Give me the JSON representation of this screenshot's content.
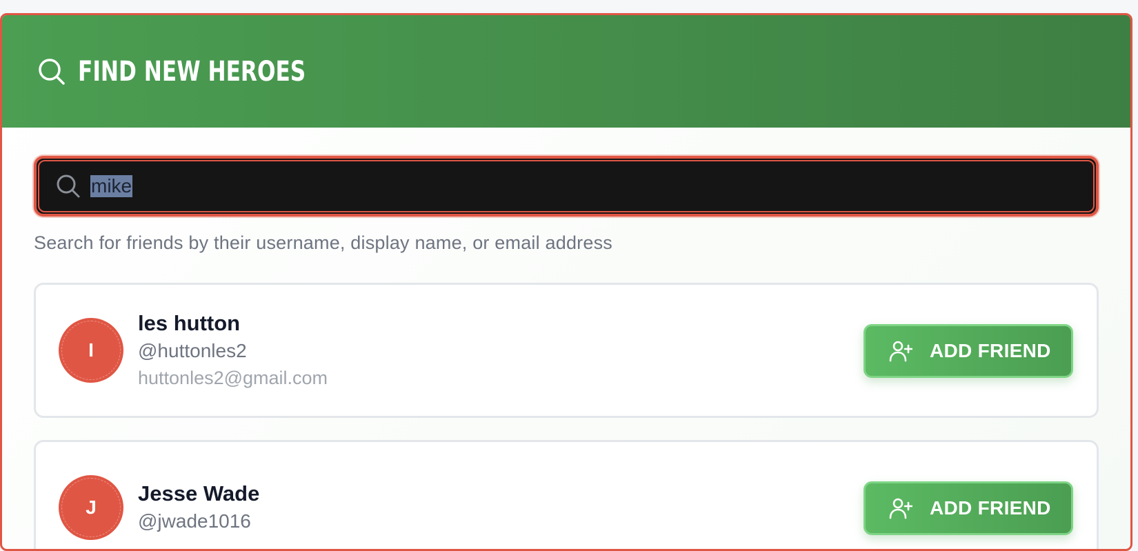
{
  "header": {
    "title": "FIND NEW HEROES",
    "icon": "search-icon"
  },
  "search": {
    "value": "mike",
    "icon": "search-icon",
    "hint": "Search for friends by their username, display name, or email address"
  },
  "results": [
    {
      "initial": "I",
      "name": "les hutton",
      "handle": "@huttonles2",
      "email": "huttonles2@gmail.com",
      "button_label": "ADD FRIEND",
      "button_icon": "user-plus-icon"
    },
    {
      "initial": "J",
      "name": "Jesse Wade",
      "handle": "@jwade1016",
      "button_label": "ADD FRIEND",
      "button_icon": "user-plus-icon"
    }
  ],
  "colors": {
    "header_green": "#4b9e52",
    "accent_red": "#e05644",
    "button_green": "#5cba63"
  }
}
